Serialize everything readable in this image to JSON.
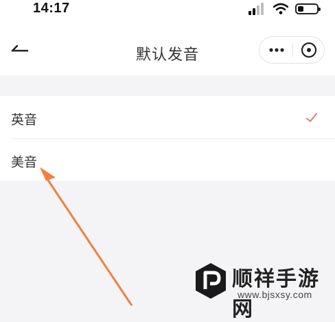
{
  "status_bar": {
    "time": "14:17",
    "icons": [
      "signal-icon",
      "wifi-icon",
      "battery-icon"
    ]
  },
  "nav": {
    "title": "默认发音",
    "back_icon": "back-arrow-icon",
    "more_icon": "more-dots-icon",
    "close_icon": "close-circle-icon"
  },
  "options": [
    {
      "label": "英音",
      "selected": true
    },
    {
      "label": "美音",
      "selected": false
    }
  ],
  "annotation": {
    "arrow_color": "#f08040"
  },
  "watermark": {
    "name": "顺祥手游网",
    "url": "www.bjsxsy.com"
  },
  "colors": {
    "accent_check": "#e07878",
    "background": "#f4f4f6"
  }
}
